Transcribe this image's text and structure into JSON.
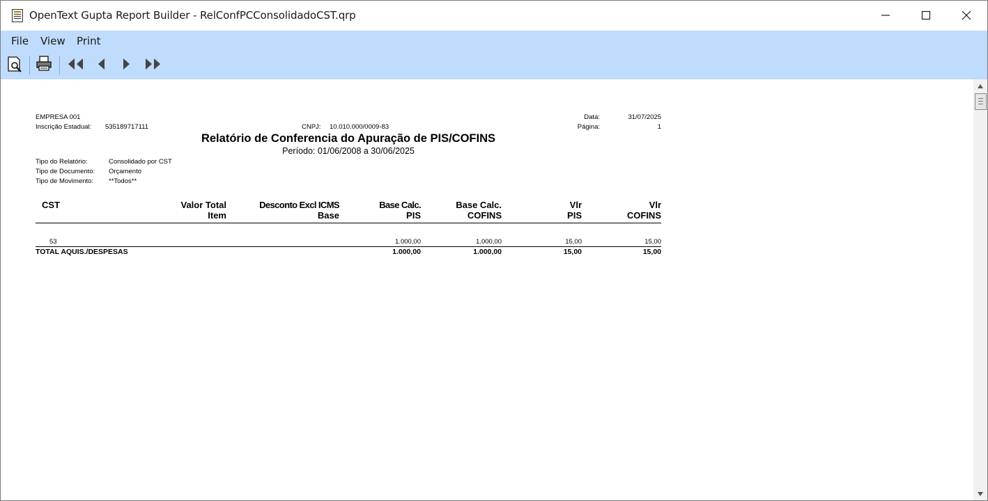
{
  "window": {
    "title": "OpenText Gupta Report Builder - RelConfPCConsolidadoCST.qrp",
    "controls": [
      "minimize-icon",
      "maximize-icon",
      "close-icon"
    ]
  },
  "menu": {
    "items": [
      "File",
      "View",
      "Print"
    ]
  },
  "toolbar": {
    "buttons": [
      "print-preview-icon",
      "printer-icon",
      "first-page-icon",
      "previous-page-icon",
      "next-page-icon",
      "last-page-icon"
    ]
  },
  "report": {
    "company": "EMPRESA 001",
    "ie_label": "Inscrição Estadual:",
    "ie_value": "535189717111",
    "cnpj_label": "CNPJ:",
    "cnpj_value": "10.010.000/0009-83",
    "date_label": "Data:",
    "date_value": "31/07/2025",
    "page_label": "Página:",
    "page_value": "1",
    "title": "Relatório de Conferencia do Apuração de PIS/COFINS",
    "period": "Período: 01/06/2008 a 30/06/2025",
    "meta": [
      {
        "label": "Tipo do Relatório:",
        "value": "Consolidado por CST"
      },
      {
        "label": "Tipo de Documento:",
        "value": "Orçamento"
      },
      {
        "label": "Tipo de Movimento:",
        "value": "**Todos**"
      }
    ],
    "columns": [
      {
        "line1": "CST",
        "line2": ""
      },
      {
        "line1": "Valor Total",
        "line2": "Item"
      },
      {
        "line1": "Desconto Excl ICMS",
        "line2": "Base"
      },
      {
        "line1": "Base Calc.",
        "line2": "PIS"
      },
      {
        "line1": "Base Calc.",
        "line2": "COFINS"
      },
      {
        "line1": "Vlr",
        "line2": "PIS"
      },
      {
        "line1": "Vlr",
        "line2": "COFINS"
      }
    ],
    "rows": [
      {
        "cst": "53",
        "base_pis": "1.000,00",
        "base_cofins": "1.000,00",
        "vlr_pis": "15,00",
        "vlr_cofins": "15,00"
      }
    ],
    "total": {
      "label": "TOTAL AQUIS./DESPESAS",
      "base_pis": "1.000,00",
      "base_cofins": "1.000,00",
      "vlr_pis": "15,00",
      "vlr_cofins": "15,00"
    }
  },
  "scrollbar": {
    "buttons": [
      "scroll-up-arrow-icon",
      "scroll-down-arrow-icon"
    ]
  }
}
